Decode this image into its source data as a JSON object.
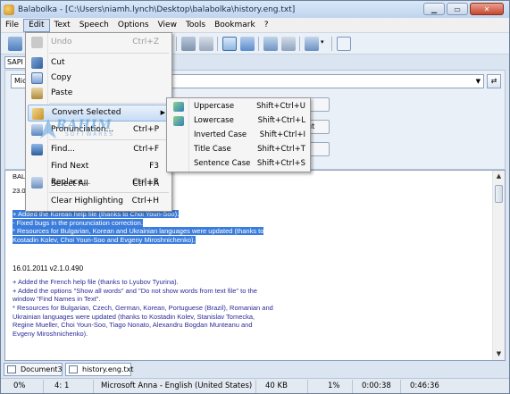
{
  "window": {
    "title": "Balabolka - [C:\\Users\\niamh.lynch\\Desktop\\balabolka\\history.eng.txt]"
  },
  "menubar": [
    "File",
    "Edit",
    "Text",
    "Speech",
    "Options",
    "View",
    "Tools",
    "Bookmark",
    "?"
  ],
  "tabs": {
    "sapi": "SAPI"
  },
  "voice": {
    "selected": "Mic"
  },
  "edit_menu": [
    {
      "label": "Undo",
      "shortcut": "Ctrl+Z",
      "disabled": true,
      "icon": "undo-icon"
    },
    {
      "label": "Cut",
      "shortcut": "",
      "icon": "scissors-icon"
    },
    {
      "label": "Copy",
      "shortcut": "",
      "icon": "copy-icon"
    },
    {
      "label": "Paste",
      "shortcut": "",
      "icon": "paste-icon"
    },
    {
      "label": "Convert Selected",
      "shortcut": "",
      "icon": "convert-icon",
      "submenu": true
    },
    {
      "label": "Pronunciation...",
      "shortcut": "Ctrl+P",
      "icon": "pronunciation-icon"
    },
    {
      "label": "Find...",
      "shortcut": "Ctrl+F",
      "icon": "binoculars-icon"
    },
    {
      "label": "Find Next",
      "shortcut": "F3",
      "icon": ""
    },
    {
      "label": "Replace...",
      "shortcut": "Ctrl+R",
      "icon": "replace-icon"
    },
    {
      "label": "Select All",
      "shortcut": "Ctrl+A",
      "icon": ""
    },
    {
      "label": "Clear Highlighting",
      "shortcut": "Ctrl+H",
      "icon": ""
    }
  ],
  "convert_submenu": [
    {
      "label": "Uppercase",
      "shortcut": "Shift+Ctrl+U",
      "icon": "uppercase-icon"
    },
    {
      "label": "Lowercase",
      "shortcut": "Shift+Ctrl+L",
      "icon": "lowercase-icon"
    },
    {
      "label": "Inverted Case",
      "shortcut": "Shift+Ctrl+I",
      "icon": ""
    },
    {
      "label": "Title Case",
      "shortcut": "Shift+Ctrl+T",
      "icon": ""
    },
    {
      "label": "Sentence Case",
      "shortcut": "Shift+Ctrl+S",
      "icon": ""
    }
  ],
  "watermark": {
    "text": "RAHIM",
    "sub": "SOFTWARES"
  },
  "editor": {
    "partial_top_1": "BAL",
    "partial_top_2": "23.0",
    "selected_lines": [
      " + Added the Korean help file (thanks to Choi Youn-Soo).",
      " - Fixed bugs in the pronunciation correction.",
      " * Resources for Bulgarian, Korean and Ukrainian languages were updated (thanks to",
      " Kostadin Kolev, Choi Youn-Soo and Evgeny Miroshnichenko)."
    ],
    "version_line": "16.01.2011    v2.1.0.490",
    "body_lines": [
      " + Added the French help file (thanks to Lyubov Tyurina).",
      " + Added the options \"Show all words\" and \"Do not show words from text file\" to the",
      "   window \"Find Names in Text\".",
      " * Resources for Bulgarian, Czech, German, Korean, Portuguese (Brazil), Romanian and",
      "   Ukrainian languages were updated (thanks to Kostadin Kolev, Stanislav Tomecka,",
      "   Regine Mueller, Choi Youn-Soo, Tiago Nonato, Alexandru Bogdan Munteanu and",
      "   Evgeny Miroshnichenko)."
    ]
  },
  "doc_tabs": [
    "Document3",
    "history.eng.txt"
  ],
  "status": {
    "progress": "0%",
    "position": "4:  1",
    "voice": "Microsoft Anna - English (United States)",
    "size": "40 KB",
    "percent": "1%",
    "elapsed": "0:00:38",
    "total": "0:46:36"
  },
  "colors": {
    "selection": "#3b7ddc",
    "text_blue": "#2b2b9a",
    "menu_highlight": "#c6dcf4"
  }
}
